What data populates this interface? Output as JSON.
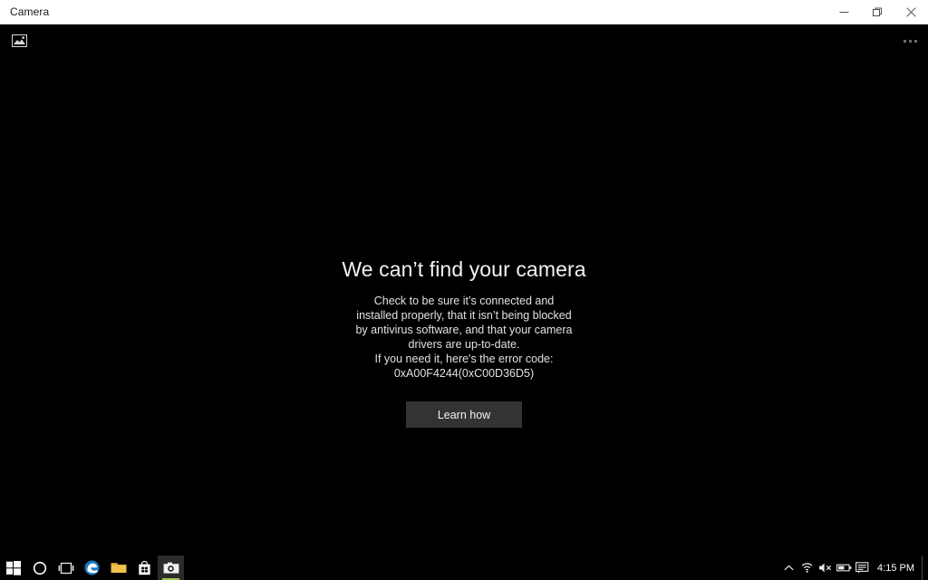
{
  "window": {
    "title": "Camera",
    "controls": {
      "minimize": "Minimize",
      "restore": "Restore",
      "close": "Close"
    },
    "titlebar_bg": "#ffffff",
    "titlebar_fg": "#1a1a1a"
  },
  "app": {
    "toolbar": {
      "gallery_label": "Gallery",
      "more_label": "See more"
    },
    "error": {
      "heading": "We can’t find your camera",
      "body_lines": [
        "Check to be sure it’s connected and",
        "installed properly, that it isn’t being blocked",
        "by antivirus software, and that your camera",
        "drivers are up-to-date.",
        "If you need it, here's the error code:"
      ],
      "error_code": "0xA00F4244(0xC00D36D5)",
      "button_label": "Learn how",
      "button_bg": "#333333",
      "text_color": "#e2e2e2",
      "heading_color": "#f2f2f2"
    },
    "background": "#000000"
  },
  "taskbar": {
    "background": "#000000",
    "items": [
      {
        "name": "start-button",
        "label": "Start",
        "active": false,
        "running": false
      },
      {
        "name": "cortana-button",
        "label": "Search",
        "active": false,
        "running": false
      },
      {
        "name": "task-view-button",
        "label": "Task View",
        "active": false,
        "running": false
      },
      {
        "name": "edge-button",
        "label": "Microsoft Edge",
        "active": false,
        "running": true
      },
      {
        "name": "file-explorer-button",
        "label": "File Explorer",
        "active": false,
        "running": false
      },
      {
        "name": "store-button",
        "label": "Microsoft Store",
        "active": false,
        "running": false
      },
      {
        "name": "camera-button",
        "label": "Camera",
        "active": true,
        "running": true
      }
    ],
    "tray": {
      "chevron_label": "Show hidden icons",
      "icons": [
        {
          "name": "wifi-icon",
          "label": "Network"
        },
        {
          "name": "speaker-muted-icon",
          "label": "Volume muted"
        },
        {
          "name": "battery-icon",
          "label": "Battery"
        },
        {
          "name": "action-center-icon",
          "label": "Notifications"
        }
      ],
      "clock": "4:15 PM",
      "show_desktop_label": "Show desktop"
    }
  }
}
